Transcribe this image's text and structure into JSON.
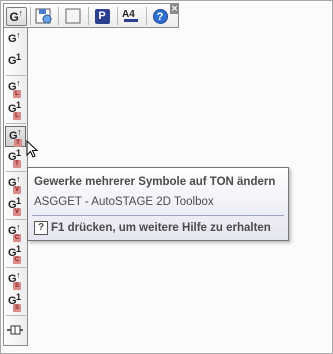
{
  "toolbar": {
    "top_buttons": [
      {
        "label": "G",
        "icon": "g-arrow-icon"
      },
      {
        "label": "",
        "icon": "save-icon"
      },
      {
        "label": "",
        "icon": "blank-page-icon"
      },
      {
        "label": "P",
        "icon": "p-icon"
      },
      {
        "label": "A4",
        "icon": "a4-icon"
      },
      {
        "label": "?",
        "icon": "help-icon"
      }
    ],
    "close_label": "×"
  },
  "vertical_tools": [
    {
      "main": "G",
      "sup": "↑",
      "sub": ""
    },
    {
      "main": "G",
      "sup": "1",
      "sub": ""
    },
    {
      "main": "G",
      "sup": "↑",
      "sub": "L"
    },
    {
      "main": "G",
      "sup": "1",
      "sub": "L"
    },
    {
      "main": "G",
      "sup": "↑",
      "sub": "T"
    },
    {
      "main": "G",
      "sup": "1",
      "sub": "T"
    },
    {
      "main": "G",
      "sup": "↑",
      "sub": "V"
    },
    {
      "main": "G",
      "sup": "1",
      "sub": "V"
    },
    {
      "main": "G",
      "sup": "↑",
      "sub": "C"
    },
    {
      "main": "G",
      "sup": "1",
      "sub": "C"
    },
    {
      "main": "G",
      "sup": "↑",
      "sub": "S"
    },
    {
      "main": "G",
      "sup": "1",
      "sub": "S"
    }
  ],
  "tooltip": {
    "title": "Gewerke mehrerer Symbole auf TON ändern",
    "subtitle": "ASGGET - AutoSTAGE 2D Toolbox",
    "help": "F1 drücken, um weitere Hilfe zu erhalten",
    "help_icon": "?"
  }
}
